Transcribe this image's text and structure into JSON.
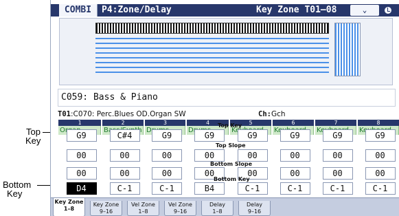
{
  "callouts": {
    "top_key": [
      "Top",
      "Key"
    ],
    "bottom_key": [
      "Bottom",
      "Key"
    ]
  },
  "header": {
    "mode": "COMBI",
    "page": "P4:Zone/Delay",
    "zone_range": "Key Zone T01–08",
    "menu_icon": "chevron-down-icon",
    "clock_icon": "clock-icon"
  },
  "combination": {
    "name": "C059: Bass & Piano"
  },
  "timbre_info": {
    "timbre": "T01",
    "program": ":C070: Perc.Blues OD.Organ SW",
    "channel_label": "Ch:",
    "channel": "Gch"
  },
  "columns": [
    {
      "num": "1",
      "category": "Organ",
      "top_key": "G9",
      "top_slope": "00",
      "bottom_slope": "00",
      "bottom_key": "D4"
    },
    {
      "num": "2",
      "category": "Bass/Synth",
      "top_key": "C#4",
      "top_slope": "00",
      "bottom_slope": "00",
      "bottom_key": "C-1"
    },
    {
      "num": "3",
      "category": "Drums",
      "top_key": "G9",
      "top_slope": "00",
      "bottom_slope": "00",
      "bottom_key": "C-1"
    },
    {
      "num": "4",
      "category": "Drums",
      "top_key": "G9",
      "top_slope": "00",
      "bottom_slope": "00",
      "bottom_key": "B4"
    },
    {
      "num": "5",
      "category": "Keyboard",
      "top_key": "G9",
      "top_slope": "00",
      "bottom_slope": "00",
      "bottom_key": "C-1"
    },
    {
      "num": "6",
      "category": "Keyboard",
      "top_key": "G9",
      "top_slope": "00",
      "bottom_slope": "00",
      "bottom_key": "C-1"
    },
    {
      "num": "7",
      "category": "Keyboard",
      "top_key": "G9",
      "top_slope": "00",
      "bottom_slope": "00",
      "bottom_key": "C-1"
    },
    {
      "num": "8",
      "category": "Keyboard",
      "top_key": "G9",
      "top_slope": "00",
      "bottom_slope": "00",
      "bottom_key": "C-1"
    }
  ],
  "row_labels": {
    "top_key": "Top Key",
    "top_slope": "Top Slope",
    "bottom_slope": "Bottom Slope",
    "bottom_key": "Bottom Key"
  },
  "tabs": [
    {
      "line1": "Key Zone",
      "line2": "1–8",
      "active": true
    },
    {
      "line1": "Key Zone",
      "line2": "9–16",
      "active": false
    },
    {
      "line1": "Vel Zone",
      "line2": "1–8",
      "active": false
    },
    {
      "line1": "Vel Zone",
      "line2": "9–16",
      "active": false
    },
    {
      "line1": "Delay",
      "line2": "1–8",
      "active": false
    },
    {
      "line1": "Delay",
      "line2": "9–16",
      "active": false
    }
  ],
  "colors": {
    "header_bg": "#27376b",
    "category_bg": "#cfe9c9",
    "zone_line": "#4a90e8"
  }
}
